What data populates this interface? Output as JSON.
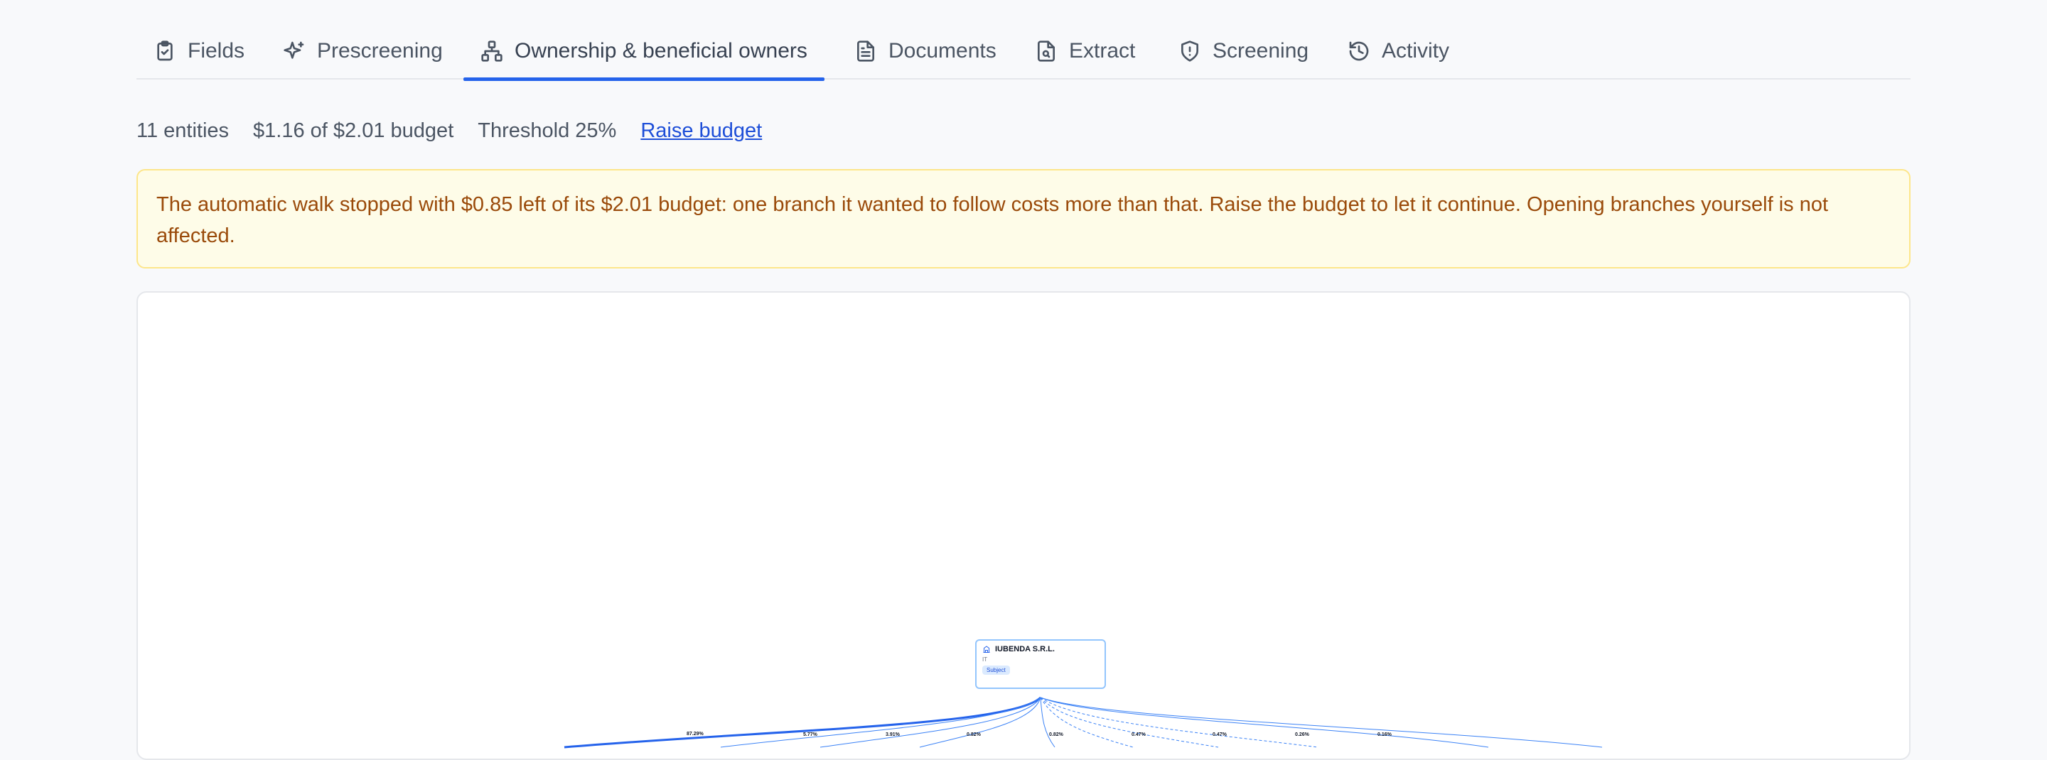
{
  "tabs": [
    {
      "label": "Fields",
      "icon": "clipboard-check-icon"
    },
    {
      "label": "Prescreening",
      "icon": "sparkles-icon"
    },
    {
      "label": "Ownership & beneficial owners",
      "icon": "network-icon",
      "active": true
    },
    {
      "label": "Documents",
      "icon": "file-text-icon"
    },
    {
      "label": "Extract",
      "icon": "file-search-icon"
    },
    {
      "label": "Screening",
      "icon": "shield-icon"
    },
    {
      "label": "Activity",
      "icon": "history-icon"
    }
  ],
  "summary": {
    "entities": "11 entities",
    "budget": "$1.16 of $2.01 budget",
    "threshold": "Threshold 25%",
    "raise_budget": "Raise budget"
  },
  "alert": {
    "message": "The automatic walk stopped with $0.85 left of its $2.01 budget: one branch it wanted to follow costs more than that. Raise the budget to let it continue. Opening branches yourself is not affected."
  },
  "graph": {
    "subject": {
      "name": "IUBENDA S.R.L.",
      "country": "IT",
      "badge": "Subject"
    },
    "edge_labels": [
      "87.29%",
      "5.77%",
      "3.91%",
      "0.82%",
      "0.82%",
      "0.47%",
      "0.47%",
      "0.26%",
      "0.16%"
    ],
    "colors": {
      "edge": "#3b82f6",
      "node_border": "#93c5fd"
    }
  }
}
